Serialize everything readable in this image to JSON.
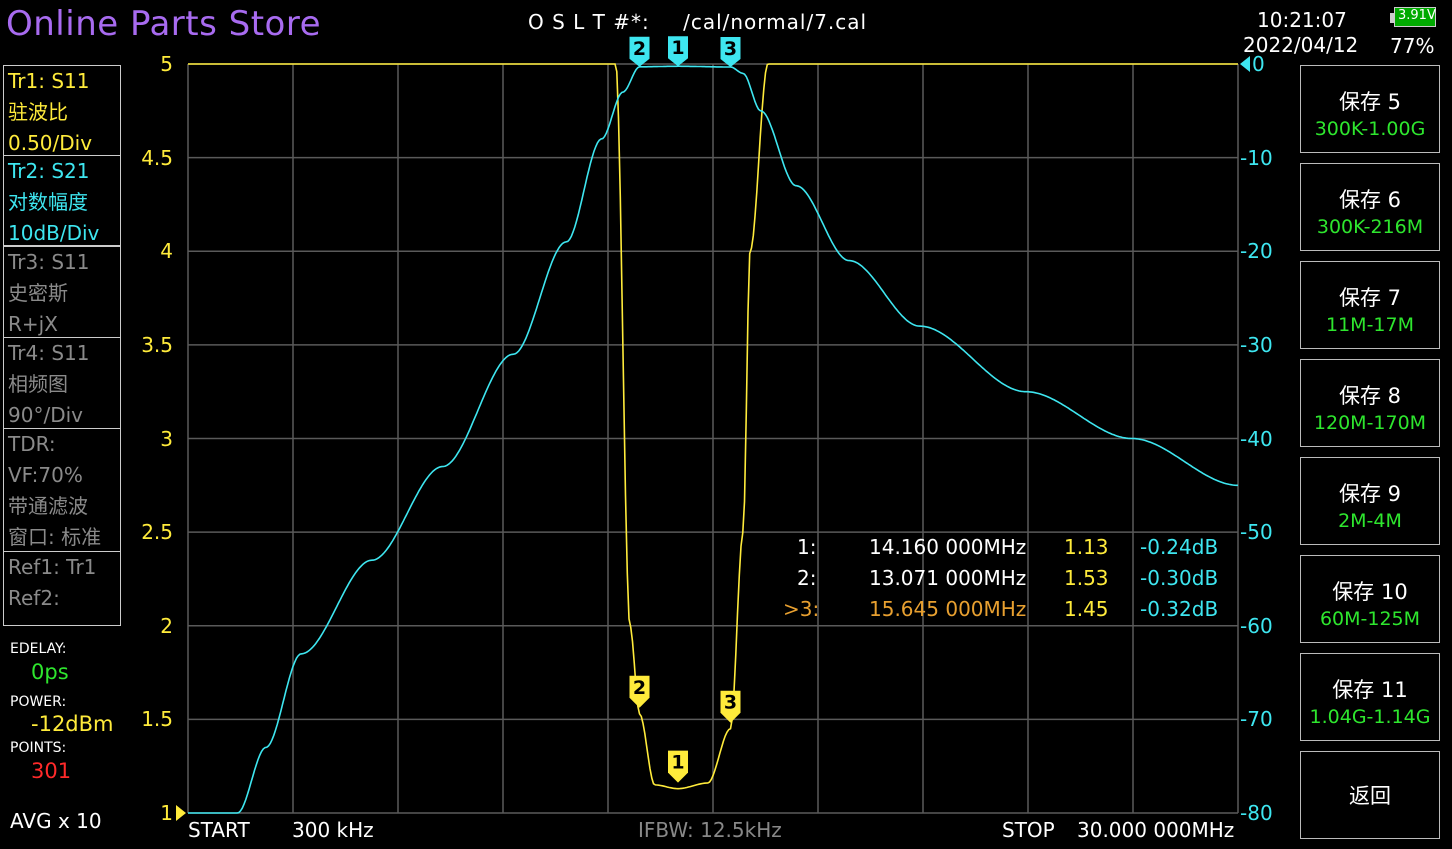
{
  "header": {
    "store_title": "Online Parts Store",
    "cal_label": "O S L T #*:",
    "cal_file": "/cal/normal/7.cal",
    "time": "10:21:07",
    "date": "2022/04/12",
    "battery_voltage": "3.91V",
    "battery_percent": "77%"
  },
  "traces": [
    {
      "line1": "Tr1:   S11",
      "line2": "驻波比",
      "line3": "0.50/Div",
      "color": "#ffeb3b"
    },
    {
      "line1": "Tr2:   S21",
      "line2": "对数幅度",
      "line3": "10dB/Div",
      "color": "#3ee6f0"
    },
    {
      "line1": "Tr3:   S11",
      "line2": "史密斯",
      "line3": "R+jX",
      "color": "#8a8a8a"
    },
    {
      "line1": "Tr4:   S11",
      "line2": "相频图",
      "line3": "90°/Div",
      "color": "#8a8a8a"
    }
  ],
  "tdr": {
    "line1": "TDR:",
    "line2": "VF:70%",
    "line3": "带通滤波",
    "line4": "窗口: 标准"
  },
  "refs": {
    "line1": "Ref1:  Tr1",
    "line2": "Ref2:"
  },
  "settings": {
    "edelay_label": "EDELAY:",
    "edelay_value": "0ps",
    "power_label": "POWER:",
    "power_value": "-12dBm",
    "points_label": "POINTS:",
    "points_value": "301",
    "avg": "AVG x 10"
  },
  "axis": {
    "left_ticks": [
      "5",
      "4.5",
      "4",
      "3.5",
      "3",
      "2.5",
      "2",
      "1.5",
      "1"
    ],
    "right_ticks": [
      "0",
      "-10",
      "-20",
      "-30",
      "-40",
      "-50",
      "-60",
      "-70",
      "-80"
    ]
  },
  "markers": [
    {
      "id": "1:",
      "freq": "14.160 000MHz",
      "swr": "1.13",
      "db": "-0.24dB",
      "active": false
    },
    {
      "id": "2:",
      "freq": "13.071 000MHz",
      "swr": "1.53",
      "db": "-0.30dB",
      "active": false
    },
    {
      "id": ">3:",
      "freq": "15.645 000MHz",
      "swr": "1.45",
      "db": "-0.32dB",
      "active": true
    }
  ],
  "marker_tags": [
    "1",
    "2",
    "3"
  ],
  "footer": {
    "start_label": "START",
    "start_value": "300 kHz",
    "ifbw": "IFBW: 12.5kHz",
    "stop_label": "STOP",
    "stop_value": "30.000 000MHz"
  },
  "buttons": [
    {
      "label": "保存 5",
      "sub": "300K-1.00G"
    },
    {
      "label": "保存 6",
      "sub": "300K-216M"
    },
    {
      "label": "保存 7",
      "sub": "11M-17M"
    },
    {
      "label": "保存 8",
      "sub": "120M-170M"
    },
    {
      "label": "保存 9",
      "sub": "2M-4M"
    },
    {
      "label": "保存 10",
      "sub": "60M-125M"
    },
    {
      "label": "保存 11",
      "sub": "1.04G-1.14G"
    },
    {
      "label": "返回",
      "sub": ""
    }
  ],
  "chart_data": {
    "type": "line",
    "x_unit": "MHz",
    "xlim": [
      0.3,
      30.0
    ],
    "y_left_lim": [
      1,
      5
    ],
    "y_right_lim": [
      -80,
      0
    ],
    "series": [
      {
        "trace": "Tr1 S11",
        "color": "#ffeb3b",
        "axis": "left",
        "x": [
          0.3,
          11.5,
          12.4,
          12.8,
          13.071,
          13.5,
          14.16,
          15.0,
          15.645,
          16.0,
          16.2,
          16.7,
          30.0
        ],
        "y": [
          5,
          5,
          5,
          2.0,
          1.53,
          1.15,
          1.13,
          1.16,
          1.45,
          2.5,
          4.0,
          5,
          5
        ]
      },
      {
        "trace": "Tr2 S21",
        "color": "#3ee6f0",
        "axis": "right",
        "x": [
          0.3,
          1.7,
          2.5,
          3.5,
          5.5,
          7.5,
          9.5,
          11.0,
          12.0,
          12.6,
          13.071,
          14.16,
          15.645,
          16.0,
          16.5,
          17.5,
          19.0,
          21.0,
          24.0,
          27.0,
          30.0
        ],
        "y": [
          -80,
          -80,
          -73,
          -63,
          -53,
          -43,
          -31,
          -19,
          -8,
          -3,
          -0.3,
          -0.24,
          -0.32,
          -1,
          -5,
          -13,
          -21,
          -28,
          -35,
          -40,
          -45
        ]
      }
    ]
  }
}
